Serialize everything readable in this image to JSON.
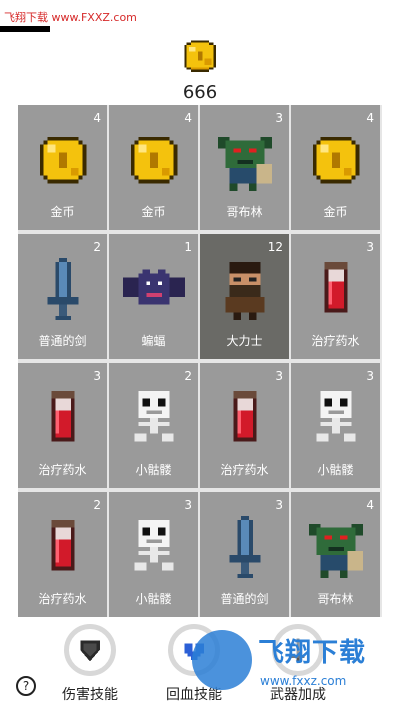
{
  "watermark": {
    "top_text": "飞翔下载 www.FXXZ.com",
    "bottom_big": "飞翔下载",
    "bottom_url": "www.fxxz.com"
  },
  "header": {
    "gold_icon": "gold-coin-icon",
    "gold_amount": "666"
  },
  "cards": [
    {
      "count": "4",
      "name": "金币",
      "icon": "gold-coin"
    },
    {
      "count": "4",
      "name": "金币",
      "icon": "gold-coin"
    },
    {
      "count": "3",
      "name": "哥布林",
      "icon": "goblin"
    },
    {
      "count": "4",
      "name": "金币",
      "icon": "gold-coin"
    },
    {
      "count": "2",
      "name": "普通的剑",
      "icon": "sword"
    },
    {
      "count": "1",
      "name": "蝙蝠",
      "icon": "bat"
    },
    {
      "count": "12",
      "name": "大力士",
      "icon": "hero",
      "selected": true
    },
    {
      "count": "3",
      "name": "治疗药水",
      "icon": "potion"
    },
    {
      "count": "3",
      "name": "治疗药水",
      "icon": "potion"
    },
    {
      "count": "2",
      "name": "小骷髅",
      "icon": "skeleton"
    },
    {
      "count": "3",
      "name": "治疗药水",
      "icon": "potion"
    },
    {
      "count": "3",
      "name": "小骷髅",
      "icon": "skeleton"
    },
    {
      "count": "2",
      "name": "治疗药水",
      "icon": "potion"
    },
    {
      "count": "3",
      "name": "小骷髅",
      "icon": "skeleton"
    },
    {
      "count": "3",
      "name": "普通的剑",
      "icon": "sword"
    },
    {
      "count": "4",
      "name": "哥布林",
      "icon": "goblin"
    }
  ],
  "bottom": {
    "help_label": "?",
    "skills": [
      {
        "label": "伤害技能",
        "icon": "shield-icon"
      },
      {
        "label": "回血技能",
        "icon": "heart-icon"
      },
      {
        "label": "武器加成",
        "icon": "weapon-icon"
      }
    ]
  },
  "colors": {
    "card_bg": "#9a9a9a",
    "card_selected_bg": "#6a6a66",
    "card_text": "#ffffff"
  }
}
